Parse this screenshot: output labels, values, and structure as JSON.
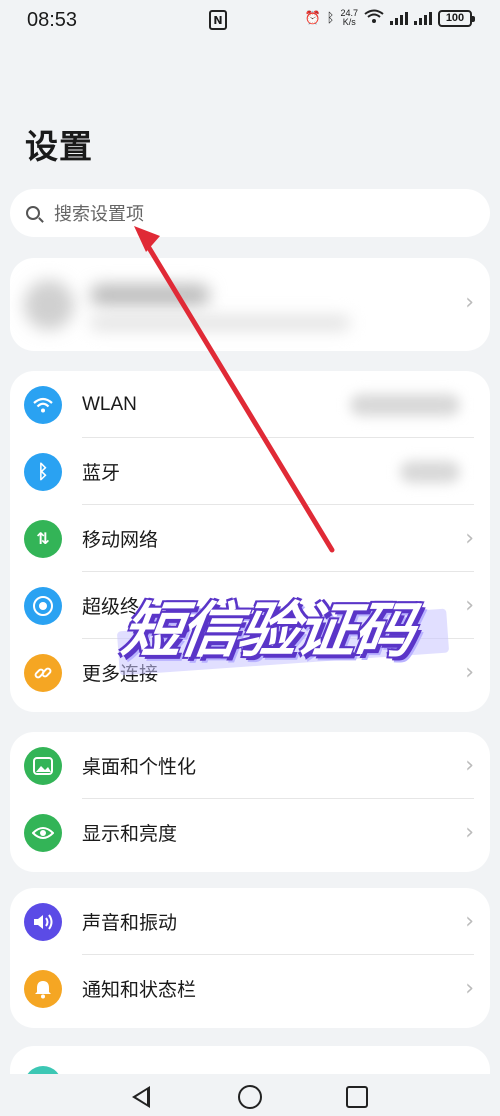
{
  "status_bar": {
    "time": "08:53",
    "nfc": "N",
    "net_speed_value": "24.7",
    "net_speed_unit": "K/s",
    "battery": "100"
  },
  "page": {
    "title": "设置"
  },
  "search": {
    "placeholder": "搜索设置项"
  },
  "groups": [
    {
      "items": [
        {
          "label": "WLAN",
          "icon": "wifi-icon",
          "color": "#2aa2f2"
        },
        {
          "label": "蓝牙",
          "icon": "bluetooth-icon",
          "color": "#2aa2f2"
        },
        {
          "label": "移动网络",
          "icon": "mobile-data-icon",
          "color": "#33b457"
        },
        {
          "label": "超级终",
          "icon": "super-device-icon",
          "color": "#2aa2f2"
        },
        {
          "label": "更多连接",
          "icon": "link-icon",
          "color": "#f5a623"
        }
      ]
    },
    {
      "items": [
        {
          "label": "桌面和个性化",
          "icon": "wallpaper-icon",
          "color": "#33b457"
        },
        {
          "label": "显示和亮度",
          "icon": "eye-icon",
          "color": "#33b457"
        }
      ]
    },
    {
      "items": [
        {
          "label": "声音和振动",
          "icon": "speaker-icon",
          "color": "#5b4be6"
        },
        {
          "label": "通知和状态栏",
          "icon": "bell-icon",
          "color": "#f5a623"
        }
      ]
    }
  ],
  "overlay": {
    "caption": "短信验证码",
    "accent": "#5a35c8",
    "arrow_color": "#e02a36"
  }
}
